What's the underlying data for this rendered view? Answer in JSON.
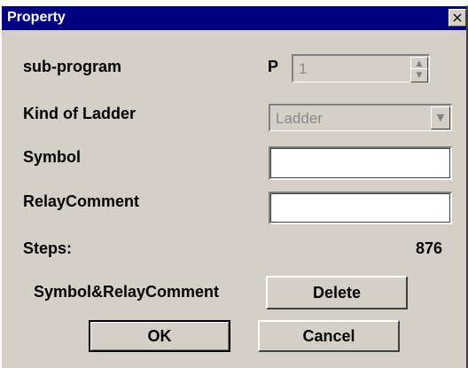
{
  "window": {
    "title": "Property",
    "close_glyph": "×"
  },
  "fields": {
    "subprogram_label": "sub-program",
    "p_label": "P",
    "p_value": "1",
    "kind_label": "Kind of Ladder",
    "kind_value": "Ladder",
    "symbol_label": "Symbol",
    "symbol_value": "",
    "relay_label": "RelayComment",
    "relay_value": "",
    "steps_label": "Steps:",
    "steps_value": "876",
    "symrelay_label": "Symbol&RelayComment"
  },
  "buttons": {
    "delete": "Delete",
    "ok": "OK",
    "cancel": "Cancel"
  },
  "icons": {
    "spin_up": "▲",
    "spin_down": "▼",
    "dropdown": "▼"
  }
}
